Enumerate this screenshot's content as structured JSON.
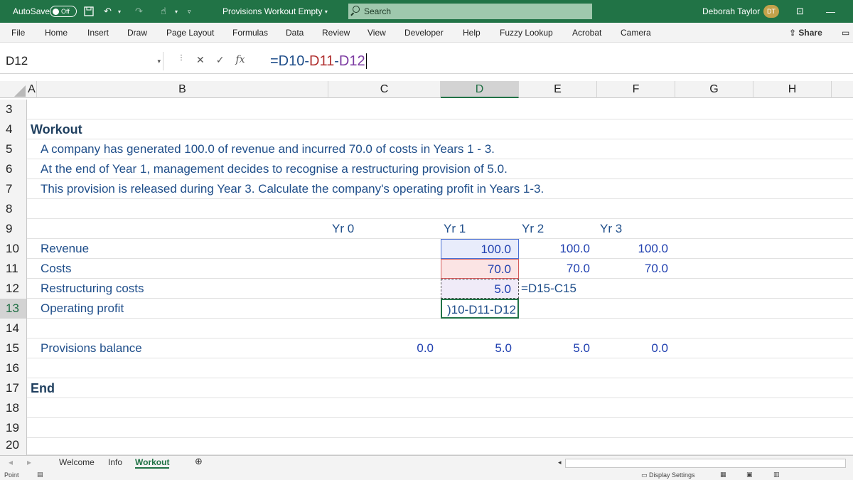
{
  "titlebar": {
    "autosave_label": "AutoSave",
    "autosave_state": "Off",
    "document_title": "Provisions Workout Empty",
    "search_placeholder": "Search",
    "user_name": "Deborah Taylor",
    "user_initials": "DT"
  },
  "ribbon": {
    "tabs": [
      "File",
      "Home",
      "Insert",
      "Draw",
      "Page Layout",
      "Formulas",
      "Data",
      "Review",
      "View",
      "Developer",
      "Help",
      "Fuzzy Lookup",
      "Acrobat",
      "Camera"
    ],
    "share_label": "Share"
  },
  "formula_bar": {
    "name_box": "D12",
    "formula_prefix": "=D10-",
    "formula_ref2": "D11",
    "formula_sep": "-",
    "formula_ref3": "D12"
  },
  "columns": [
    "A",
    "B",
    "C",
    "D",
    "E",
    "F",
    "G",
    "H"
  ],
  "rows": {
    "r3": "3",
    "r4": "4",
    "r5": "5",
    "r6": "6",
    "r7": "7",
    "r8": "8",
    "r9": "9",
    "r10": "10",
    "r11": "11",
    "r12": "12",
    "r13": "13",
    "r14": "14",
    "r15": "15",
    "r16": "16",
    "r17": "17",
    "r18": "18",
    "r19": "19",
    "r20": "20"
  },
  "sheet": {
    "workout_heading": "Workout",
    "line1": "A company has generated 100.0 of revenue and incurred 70.0 of costs in Years 1 - 3.",
    "line2": "At the end of Year 1, management decides to recognise a restructuring provision of 5.0.",
    "line3": "This provision is released during Year 3. Calculate the company's operating profit in Years 1-3.",
    "yr0": "Yr 0",
    "yr1": "Yr 1",
    "yr2": "Yr 2",
    "yr3": "Yr 3",
    "revenue_label": "Revenue",
    "costs_label": "Costs",
    "restructuring_label": "Restructuring costs",
    "operating_label": "Operating profit",
    "provisions_label": "Provisions balance",
    "end_heading": "End",
    "rev_d": "100.0",
    "rev_e": "100.0",
    "rev_f": "100.0",
    "cost_d": "70.0",
    "cost_e": "70.0",
    "cost_f": "70.0",
    "restr_d": "5.0",
    "restr_e_edit": "=D15-C15",
    "op_d_edit": ")10-D11-D12",
    "prov_c": "0.0",
    "prov_d": "5.0",
    "prov_e": "5.0",
    "prov_f": "0.0"
  },
  "sheet_tabs": [
    "Welcome",
    "Info",
    "Workout"
  ],
  "status": {
    "mode": "Point",
    "display_settings": "Display Settings"
  }
}
